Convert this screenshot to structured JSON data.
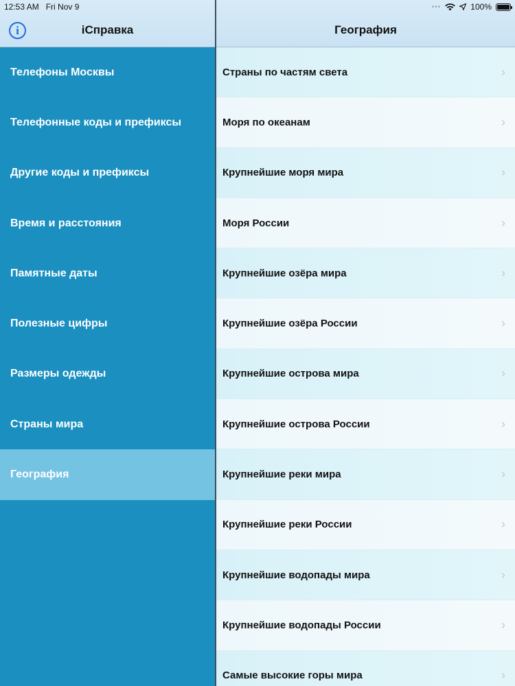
{
  "status_bar": {
    "time": "12:53 AM",
    "date": "Fri Nov 9",
    "battery": "100%"
  },
  "master": {
    "title": "iСправка",
    "info_icon": "info-icon",
    "items": [
      {
        "label": "Телефоны Москвы"
      },
      {
        "label": "Телефонные коды и префиксы"
      },
      {
        "label": "Другие коды и префиксы"
      },
      {
        "label": "Время и расстояния"
      },
      {
        "label": "Памятные даты"
      },
      {
        "label": "Полезные цифры"
      },
      {
        "label": "Размеры одежды"
      },
      {
        "label": "Страны мира"
      },
      {
        "label": "География",
        "selected": true
      }
    ]
  },
  "detail": {
    "title": "География",
    "items": [
      {
        "label": "Страны по частям света"
      },
      {
        "label": "Моря по океанам"
      },
      {
        "label": "Крупнейшие моря мира"
      },
      {
        "label": "Моря России"
      },
      {
        "label": "Крупнейшие озёра мира"
      },
      {
        "label": "Крупнейшие озёра России"
      },
      {
        "label": "Крупнейшие острова мира"
      },
      {
        "label": "Крупнейшие острова России"
      },
      {
        "label": "Крупнейшие реки мира"
      },
      {
        "label": "Крупнейшие реки России"
      },
      {
        "label": "Крупнейшие водопады мира"
      },
      {
        "label": "Крупнейшие водопады России"
      },
      {
        "label": "Самые высокие горы мира"
      }
    ]
  },
  "colors": {
    "sidebar_bg": "#1a8fc0",
    "sidebar_selected": "#74c3e3",
    "header_bg": "#d3e8f6",
    "accent": "#1e6be0"
  }
}
